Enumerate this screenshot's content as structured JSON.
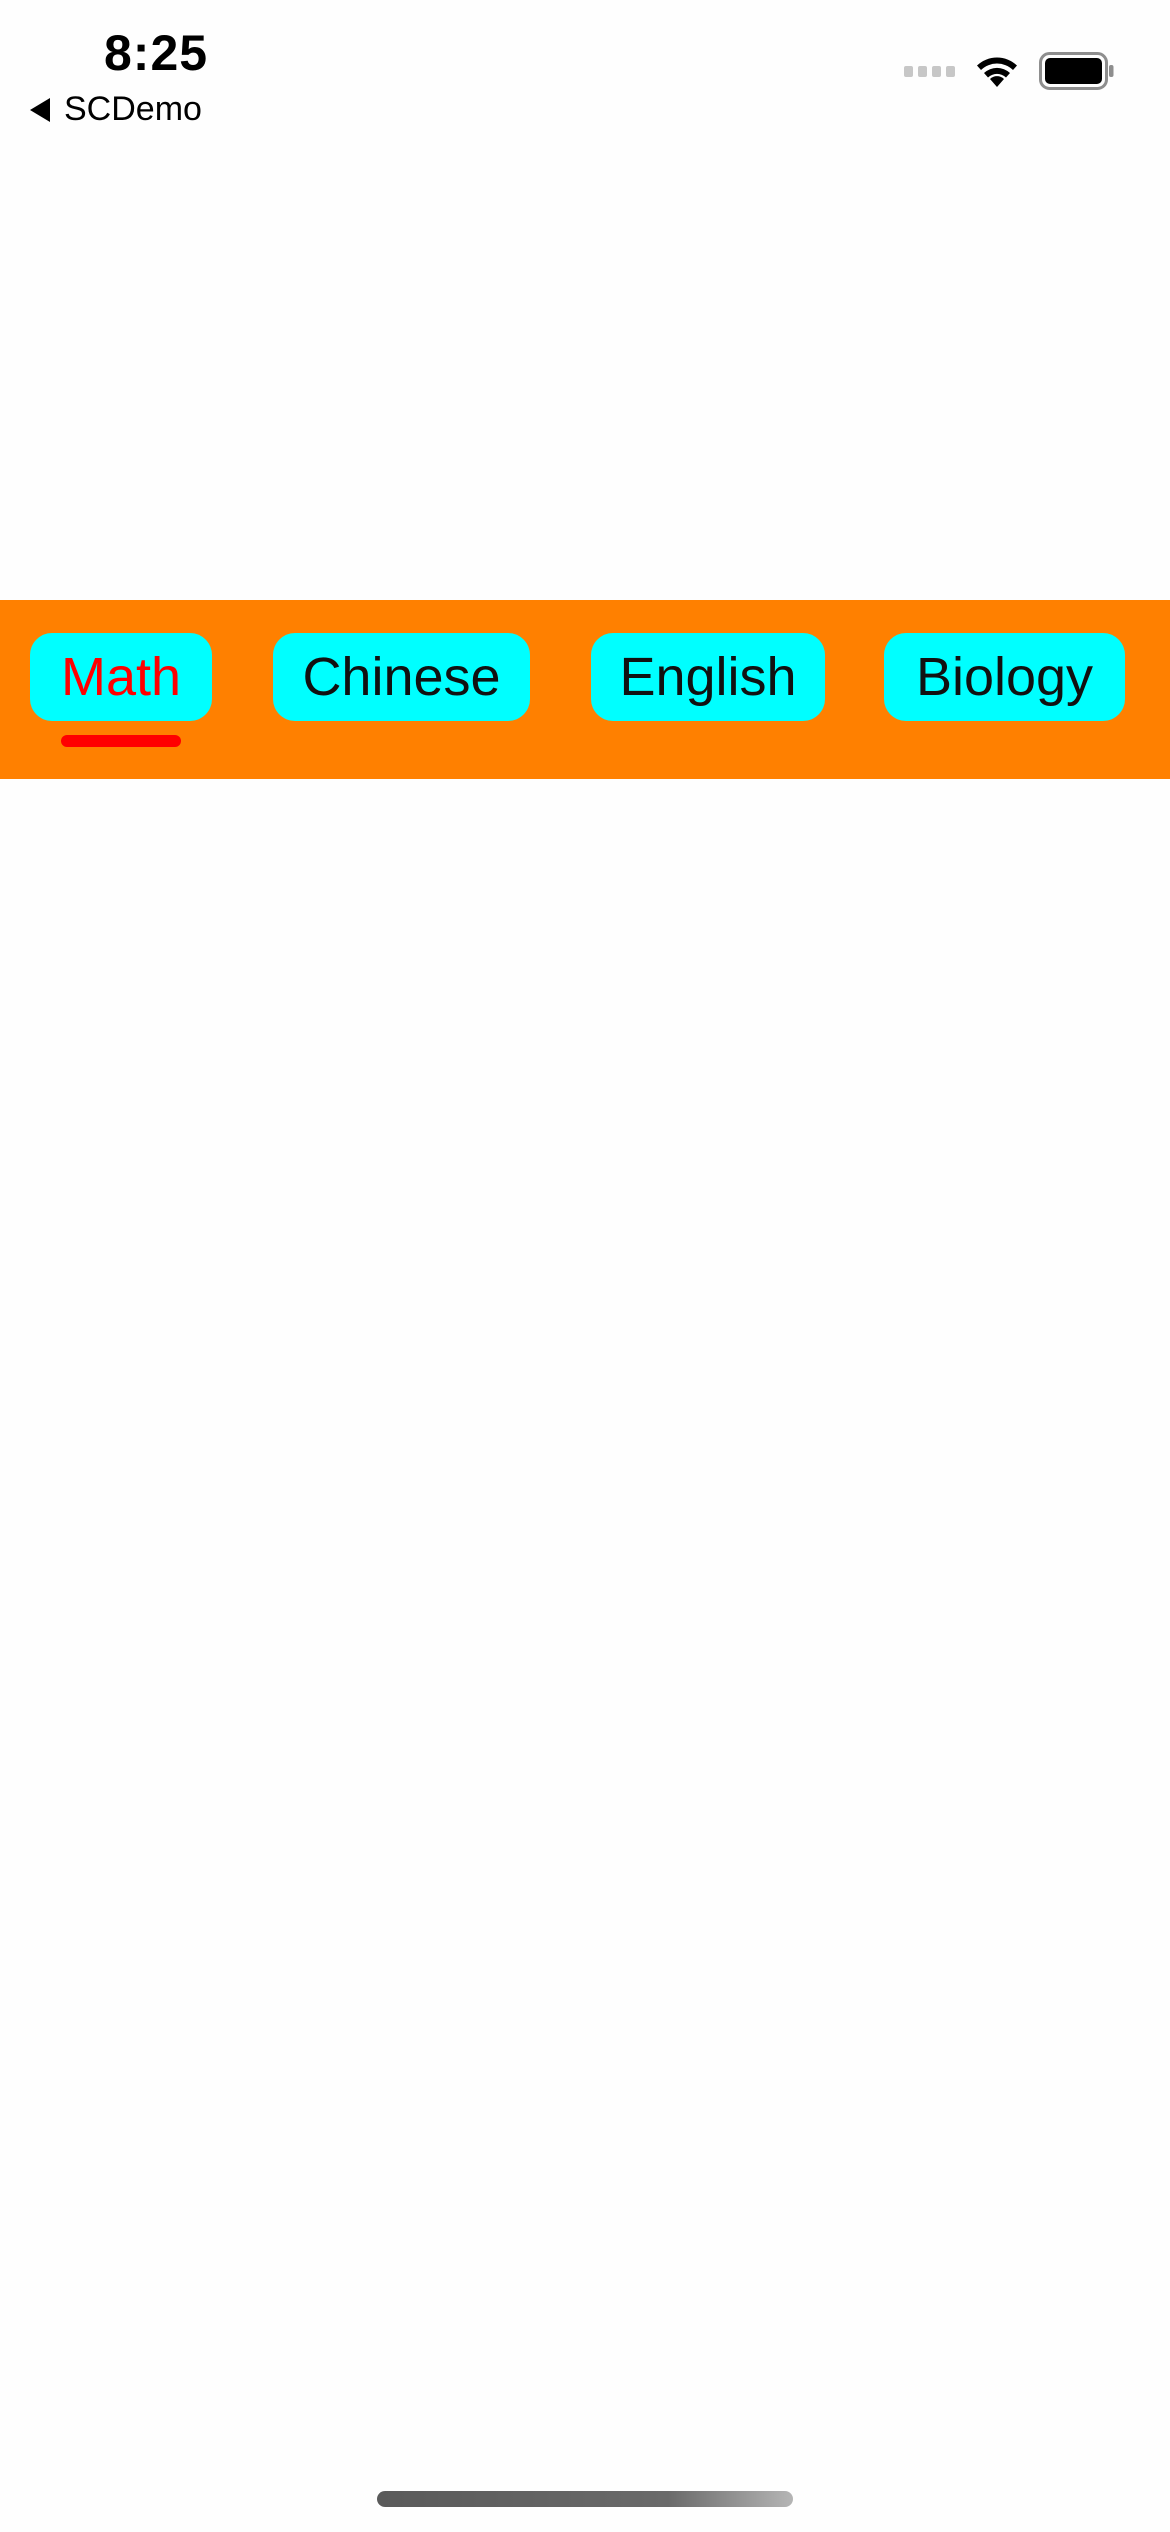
{
  "status_bar": {
    "time": "8:25",
    "back_app_label": "SCDemo",
    "icons": [
      "signal-dots-icon",
      "wifi-icon",
      "battery-icon"
    ]
  },
  "tab_bar": {
    "background_color": "#ff8000",
    "tab_color": "#00ffff",
    "active_color": "#ff0000",
    "selected_index": 0,
    "tabs": [
      {
        "label": "Math"
      },
      {
        "label": "Chinese"
      },
      {
        "label": "English"
      },
      {
        "label": "Biology"
      }
    ]
  }
}
